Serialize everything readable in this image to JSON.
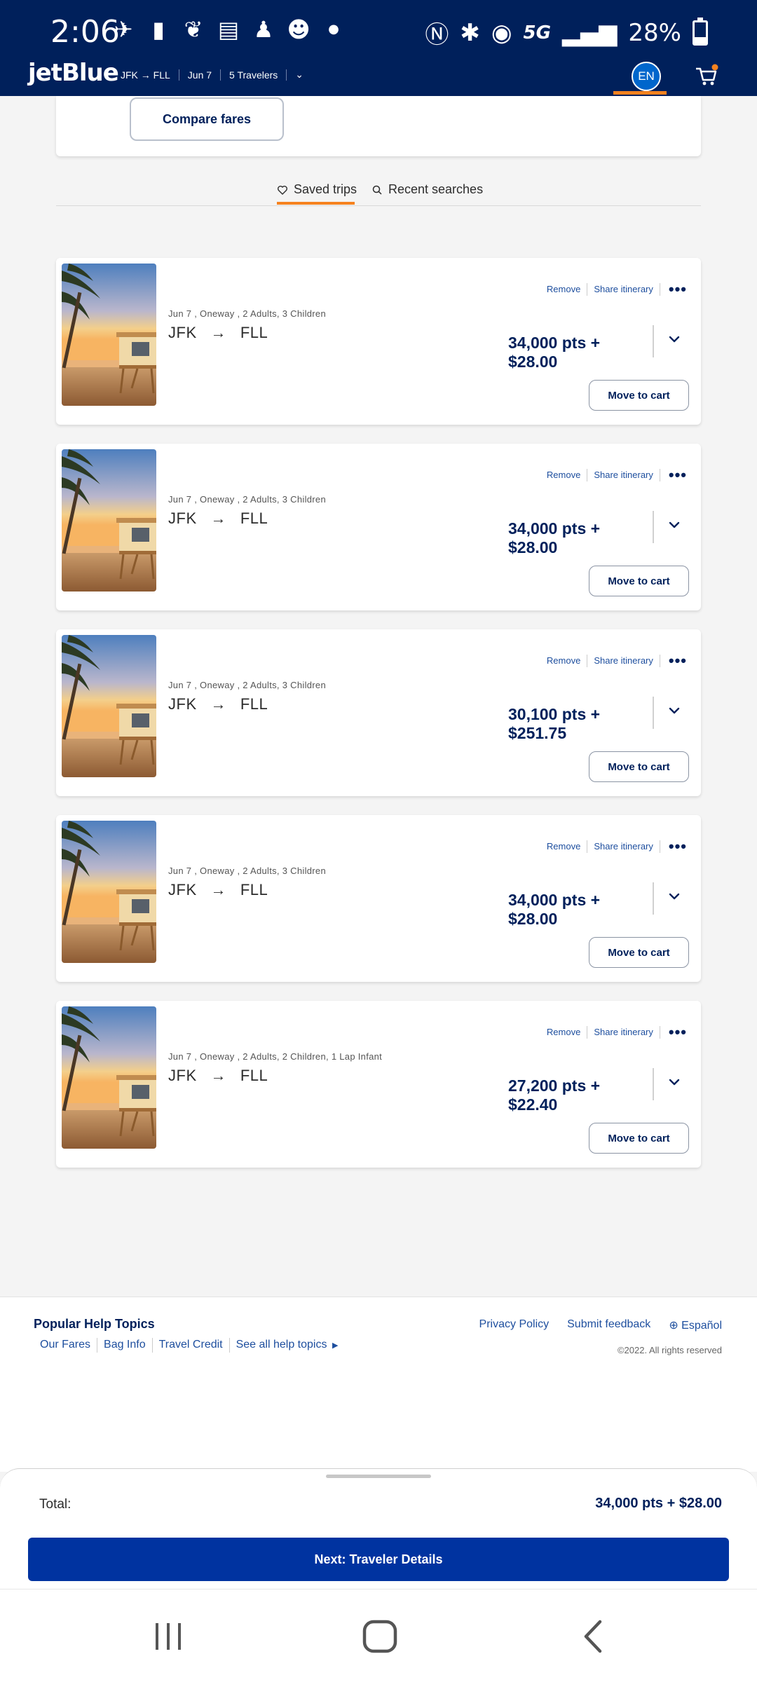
{
  "status_bar": {
    "time": "2:06",
    "network": "5G",
    "battery": "28%"
  },
  "header": {
    "logo": "jetBlue",
    "origin": "JFK",
    "arrow": "→",
    "destination": "FLL",
    "date": "Jun 7",
    "travelers": "5 Travelers",
    "language": "EN",
    "accent_color": "#f5821f",
    "brand_color": "#00205b"
  },
  "compare": {
    "button_label": "Compare fares"
  },
  "tabs": [
    {
      "label": "Saved trips",
      "icon": "heart-icon",
      "active": true
    },
    {
      "label": "Recent searches",
      "icon": "search-icon",
      "active": false
    }
  ],
  "trip_actions": {
    "remove": "Remove",
    "share": "Share itinerary",
    "move_to_cart": "Move to cart"
  },
  "trips": [
    {
      "meta": "Jun 7 , Oneway ,  2 Adults, 3 Children",
      "origin": "JFK",
      "destination": "FLL",
      "price_line1": "34,000 pts +",
      "price_line2": "$28.00"
    },
    {
      "meta": "Jun 7 , Oneway ,  2 Adults, 3 Children",
      "origin": "JFK",
      "destination": "FLL",
      "price_line1": "34,000 pts +",
      "price_line2": "$28.00"
    },
    {
      "meta": "Jun 7 , Oneway ,  2 Adults, 3 Children",
      "origin": "JFK",
      "destination": "FLL",
      "price_line1": "30,100 pts +",
      "price_line2": "$251.75"
    },
    {
      "meta": "Jun 7 , Oneway ,  2 Adults, 3 Children",
      "origin": "JFK",
      "destination": "FLL",
      "price_line1": "34,000 pts +",
      "price_line2": "$28.00"
    },
    {
      "meta": "Jun 7 , Oneway ,  2 Adults, 2 Children, 1 Lap Infant",
      "origin": "JFK",
      "destination": "FLL",
      "price_line1": "27,200 pts +",
      "price_line2": "$22.40"
    }
  ],
  "footer": {
    "help_title": "Popular Help Topics",
    "help_links": [
      "Our Fares",
      "Bag Info",
      "Travel Credit",
      "See all help topics"
    ],
    "privacy": "Privacy Policy",
    "feedback": "Submit feedback",
    "language": "Español",
    "copyright": "©2022. All rights reserved"
  },
  "checkout": {
    "total_label": "Total:",
    "total_value": "34,000 pts + $28.00",
    "next_label": "Next: Traveler Details"
  }
}
